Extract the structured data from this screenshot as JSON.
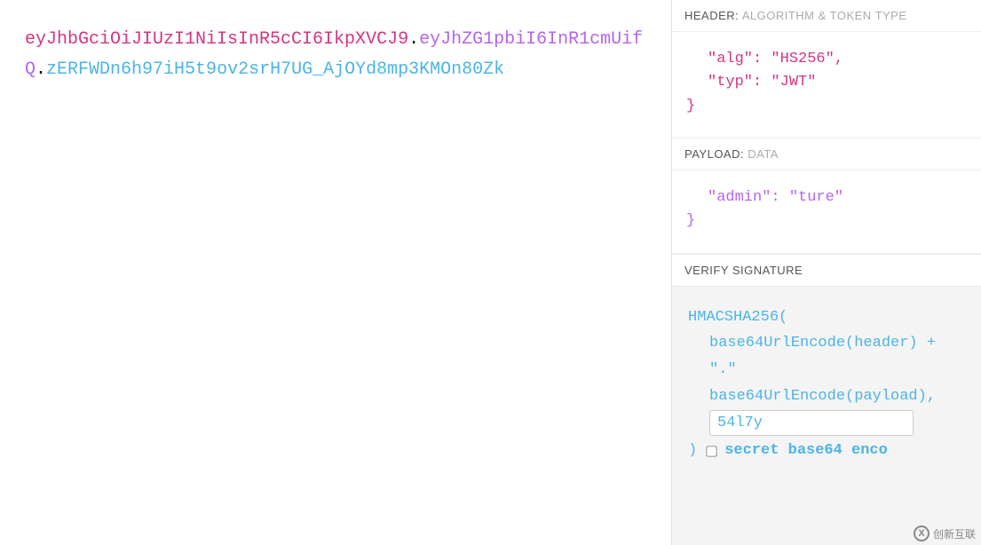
{
  "jwt": {
    "header": "eyJhbGciOiJIUzI1NiIsInR5cCI6IkpXVCJ9",
    "payload": "eyJhZG1pbiI6InR1cmUifQ",
    "signature": "zERFWDn6h97iH5t9ov2srH7UG_AjOYd8mp3KMOn80Zk"
  },
  "headerSection": {
    "label": "HEADER:",
    "sub": "ALGORITHM & TOKEN TYPE",
    "line1_key": "\"alg\"",
    "line1_val": "\"HS256\"",
    "line2_key": "\"typ\"",
    "line2_val": "\"JWT\""
  },
  "payloadSection": {
    "label": "PAYLOAD:",
    "sub": "DATA",
    "line1_key": "\"admin\"",
    "line1_val": "\"ture\""
  },
  "verifySection": {
    "label": "VERIFY SIGNATURE",
    "algoOpen": "HMACSHA256(",
    "line1": "base64UrlEncode(header) + \".\"",
    "line2": "base64UrlEncode(payload),",
    "secretValue": "54l7y",
    "closeParen": ")",
    "secretLabel": "secret base64 enco"
  },
  "watermark": {
    "text": "创新互联",
    "icon": "X"
  }
}
